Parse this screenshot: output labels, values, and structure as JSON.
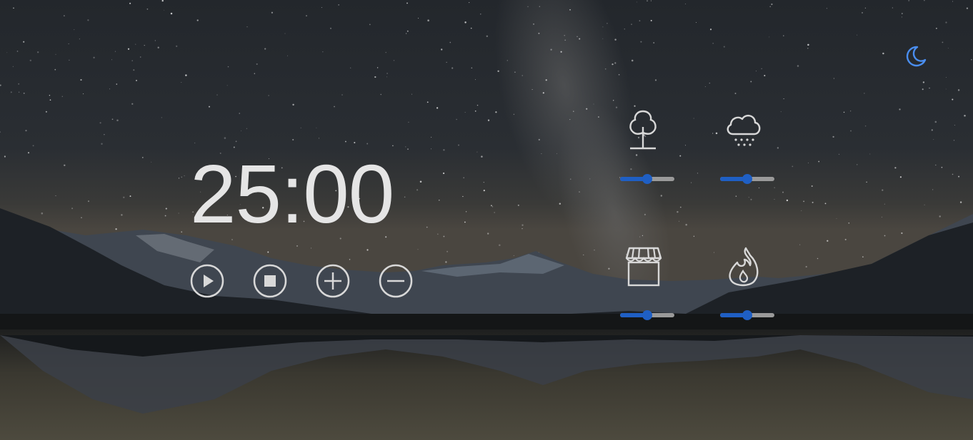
{
  "timer": {
    "display": "25:00"
  },
  "theme": {
    "icon": "moon-icon",
    "accent": "#4a8ef0"
  },
  "controls": [
    {
      "name": "play-button",
      "icon": "play-icon"
    },
    {
      "name": "stop-button",
      "icon": "stop-icon"
    },
    {
      "name": "add-time-button",
      "icon": "plus-icon"
    },
    {
      "name": "subtract-time-button",
      "icon": "minus-icon"
    }
  ],
  "sounds": [
    {
      "name": "forest",
      "icon": "tree-icon",
      "volume": 0.5
    },
    {
      "name": "rain",
      "icon": "rain-cloud-icon",
      "volume": 0.5
    },
    {
      "name": "coffee-shop",
      "icon": "storefront-icon",
      "volume": 0.5
    },
    {
      "name": "fireplace",
      "icon": "fire-icon",
      "volume": 0.5
    }
  ],
  "colors": {
    "icon": "#d8d8d8",
    "slider_fill": "#1f5fc4",
    "slider_track": "#9a9a9a"
  }
}
